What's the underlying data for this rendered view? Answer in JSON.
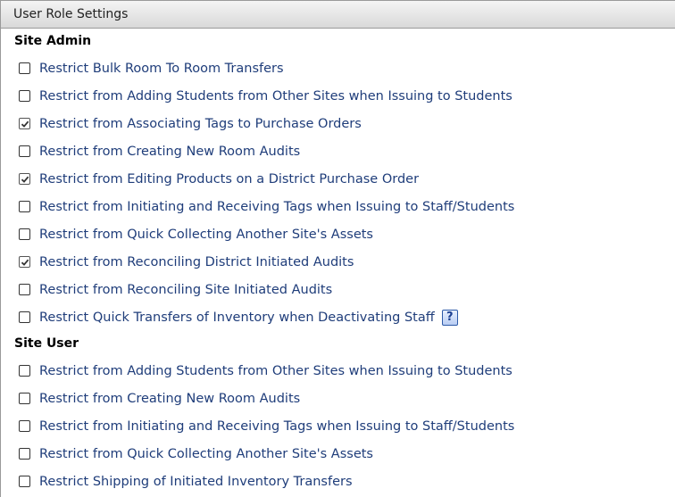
{
  "header": {
    "title": "User Role Settings"
  },
  "sections": [
    {
      "title": "Site Admin",
      "items": [
        {
          "label": "Restrict Bulk Room To Room Transfers",
          "checked": false
        },
        {
          "label": "Restrict from Adding Students from Other Sites when Issuing to Students",
          "checked": false
        },
        {
          "label": "Restrict from Associating Tags to Purchase Orders",
          "checked": true
        },
        {
          "label": "Restrict from Creating New Room Audits",
          "checked": false
        },
        {
          "label": "Restrict from Editing Products on a District Purchase Order",
          "checked": true
        },
        {
          "label": "Restrict from Initiating and Receiving Tags when Issuing to Staff/Students",
          "checked": false
        },
        {
          "label": "Restrict from Quick Collecting Another Site's Assets",
          "checked": false
        },
        {
          "label": "Restrict from Reconciling District Initiated Audits",
          "checked": true
        },
        {
          "label": "Restrict from Reconciling Site Initiated Audits",
          "checked": false
        },
        {
          "label": "Restrict Quick Transfers of Inventory when Deactivating Staff",
          "checked": false,
          "help": "?"
        }
      ]
    },
    {
      "title": "Site User",
      "items": [
        {
          "label": "Restrict from Adding Students from Other Sites when Issuing to Students",
          "checked": false
        },
        {
          "label": "Restrict from Creating New Room Audits",
          "checked": false
        },
        {
          "label": "Restrict from Initiating and Receiving Tags when Issuing to Staff/Students",
          "checked": false
        },
        {
          "label": "Restrict from Quick Collecting Another Site's Assets",
          "checked": false
        },
        {
          "label": "Restrict Shipping of Initiated Inventory Transfers",
          "checked": false
        }
      ]
    }
  ]
}
